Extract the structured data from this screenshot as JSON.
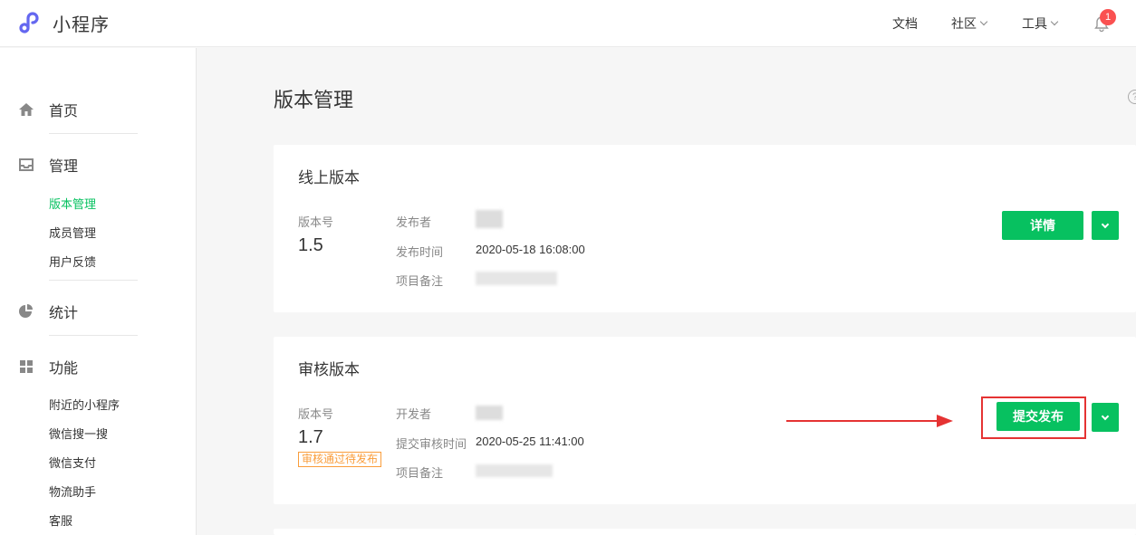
{
  "header": {
    "app_name": "小程序",
    "nav": {
      "docs": "文档",
      "community": "社区",
      "tools": "工具"
    },
    "notification_count": "1"
  },
  "sidebar": {
    "groups": [
      {
        "label": "首页",
        "icon": "home-icon"
      },
      {
        "label": "管理",
        "icon": "inbox-icon",
        "items": [
          "版本管理",
          "成员管理",
          "用户反馈"
        ]
      },
      {
        "label": "统计",
        "icon": "pie-chart-icon"
      },
      {
        "label": "功能",
        "icon": "grid-icon",
        "items": [
          "附近的小程序",
          "微信搜一搜",
          "微信支付",
          "物流助手",
          "客服"
        ]
      }
    ],
    "active_item": "版本管理"
  },
  "main": {
    "title": "版本管理",
    "online": {
      "title": "线上版本",
      "version_label": "版本号",
      "version": "1.5",
      "fields": [
        {
          "label": "发布者",
          "value": ""
        },
        {
          "label": "发布时间",
          "value": "2020-05-18 16:08:00"
        },
        {
          "label": "项目备注",
          "value": ""
        }
      ],
      "button": "详情"
    },
    "review": {
      "title": "审核版本",
      "version_label": "版本号",
      "version": "1.7",
      "status": "审核通过待发布",
      "fields": [
        {
          "label": "开发者",
          "value": ""
        },
        {
          "label": "提交审核时间",
          "value": "2020-05-25 11:41:00"
        },
        {
          "label": "项目备注",
          "value": ""
        }
      ],
      "button": "提交发布"
    }
  },
  "colors": {
    "accent": "#07c160",
    "warning": "#fa9d3b",
    "annotation": "#e53333",
    "badge": "#fa5151"
  }
}
